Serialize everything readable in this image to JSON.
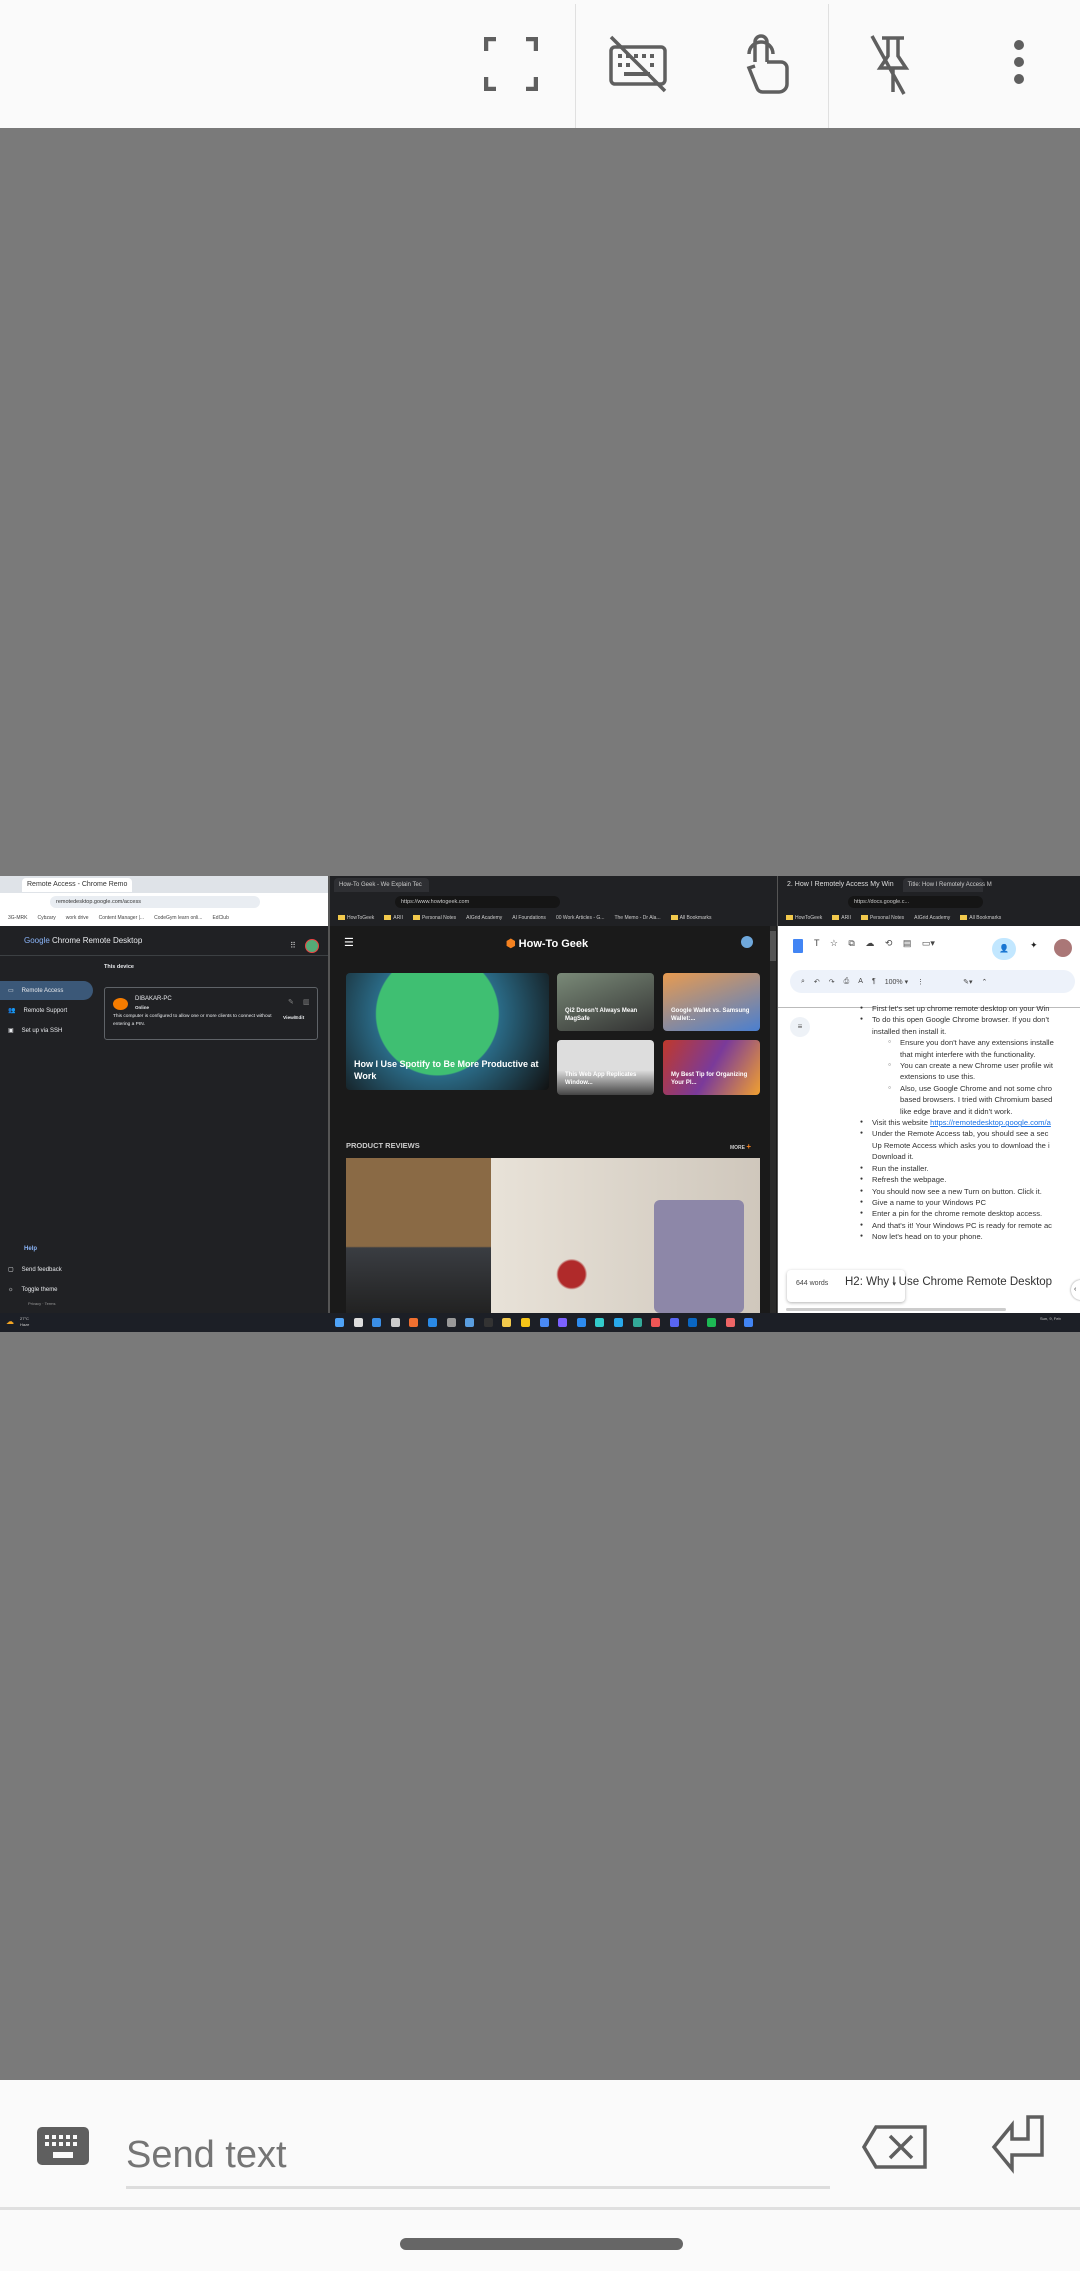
{
  "toolbar": {
    "icons": [
      "fullscreen-icon",
      "keyboard-off-icon",
      "touch-mode-icon",
      "unpin-icon",
      "more-vert-icon"
    ]
  },
  "remote": {
    "crd": {
      "tab_title": "Remote Access - Chrome Remo",
      "url": "remotedesktop.google.com/access",
      "bookmarks": [
        "3G-MRK",
        "Cybzary",
        "work drive",
        "Content Manager |...",
        "CodeGym learn onli...",
        "EdClub"
      ],
      "brand_google": "Google",
      "brand_app": "Chrome Remote Desktop",
      "section": "This device",
      "nav": [
        "Remote Access",
        "Remote Support",
        "Set up via SSH"
      ],
      "device_name": "DIBAKAR-PC",
      "device_status": "Online",
      "device_desc": "This computer is configured to allow one or more clients to connect without entering a PIN.",
      "view_edit": "View/Edit",
      "help": "Help",
      "send_feedback": "Send feedback",
      "toggle_theme": "Toggle theme",
      "privacy_terms": "Privacy · Terms"
    },
    "htg": {
      "tab_title": "How-To Geek - We Explain Tec",
      "url": "https://www.howtogeek.com",
      "bookmarks": [
        "HowToGeek",
        "ARII",
        "Personal Notes",
        "AIGrid Academy",
        "AI Foundations",
        "00 Work Articles - G...",
        "The Memo - Dr Ala...",
        "All Bookmarks"
      ],
      "logo": "How-To Geek",
      "featured": "How I Use Spotify to Be More Productive at Work",
      "cards": [
        "Qi2 Doesn't Always Mean MagSafe",
        "Google Wallet vs. Samsung Wallet:...",
        "This Web App Replicates Window...",
        "My Best Tip for Organizing Your Pl..."
      ],
      "section": "PRODUCT REVIEWS",
      "more": "MORE"
    },
    "docs": {
      "tabs": [
        "2. How I Remotely Access My Win",
        "Title: How I Remotely Access M"
      ],
      "url": "https://docs.google.c...",
      "bookmarks": [
        "HowToGeek",
        "ARII",
        "Personal Notes",
        "AIGrid Academy",
        "All Bookmarks"
      ],
      "zoom": "100%",
      "lines": [
        {
          "t": "li",
          "text": "First let's set up chrome remote desktop on your Win"
        },
        {
          "t": "li",
          "text": "To do this open Google Chrome browser. If you don't"
        },
        {
          "t": "c",
          "text": "installed then install it."
        },
        {
          "t": "li2",
          "text": "Ensure you don't have any extensions installe"
        },
        {
          "t": "c2",
          "text": "that might interfere with the functionality."
        },
        {
          "t": "li2",
          "text": "You can create a new Chrome user profile wit"
        },
        {
          "t": "c2",
          "text": "extensions to use this."
        },
        {
          "t": "li2",
          "text": "Also, use Google Chrome and not some chro"
        },
        {
          "t": "c2",
          "text": "based browsers. I tried with Chromium based"
        },
        {
          "t": "c2",
          "text": "like edge brave and it didn't work."
        },
        {
          "t": "li",
          "text": "Visit this website ",
          "link": "https://remotedesktop.google.com/a"
        },
        {
          "t": "li",
          "text": "Under the Remote Access tab, you should see a sec"
        },
        {
          "t": "c",
          "text": "Up Remote Access which asks you to download the i"
        },
        {
          "t": "c",
          "text": "Download it."
        },
        {
          "t": "li",
          "text": "Run the installer."
        },
        {
          "t": "li",
          "text": "Refresh the webpage."
        },
        {
          "t": "li",
          "text": "You should now see a new Turn on button. Click it."
        },
        {
          "t": "li",
          "text": "Give a name to your Windows PC"
        },
        {
          "t": "li",
          "text": "Enter a pin for the chrome remote desktop access."
        },
        {
          "t": "li",
          "text": "And that's it! Your Windows PC is ready for remote ac"
        },
        {
          "t": "li",
          "text": "Now let's head on to your phone."
        }
      ],
      "heading": "H2: Why I Use Chrome Remote Desktop",
      "word_count": "644 words"
    },
    "taskbar": {
      "weather_temp": "27°C",
      "weather_desc": "Haze",
      "date": "Sun, 9, Feb"
    }
  },
  "bottom": {
    "placeholder": "Send text"
  },
  "colors": {
    "topbar": "#fafafa",
    "canvas": "#7a7a7a",
    "icon": "#5f5f5f",
    "htg_orange": "#f58220",
    "docs_blue": "#1a73e8"
  }
}
